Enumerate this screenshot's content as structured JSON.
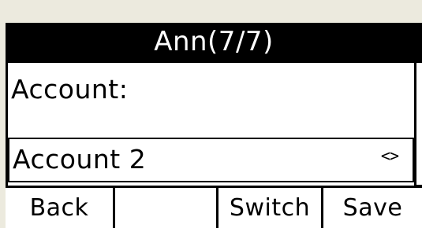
{
  "title": "Ann(7/7)",
  "field": {
    "label": "Account:",
    "value": "Account 2",
    "arrows": "<>"
  },
  "softkeys": {
    "key1": "Back",
    "key2": "",
    "key3": "Switch",
    "key4": "Save"
  },
  "colors": {
    "background": "#eceade",
    "screen": "#000000",
    "text": "#000000",
    "title_text": "#ffffff"
  }
}
